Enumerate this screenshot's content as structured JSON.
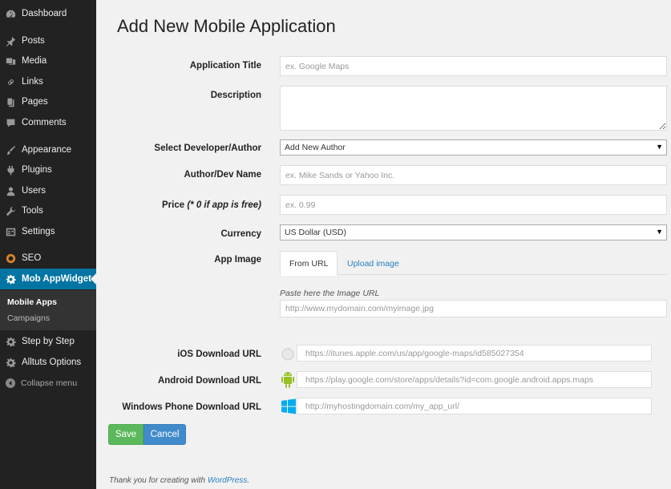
{
  "sidebar": {
    "items": [
      {
        "label": "Dashboard",
        "icon": "dashboard-icon"
      },
      {
        "label": "Posts",
        "icon": "pin-icon"
      },
      {
        "label": "Media",
        "icon": "media-icon"
      },
      {
        "label": "Links",
        "icon": "link-icon"
      },
      {
        "label": "Pages",
        "icon": "pages-icon"
      },
      {
        "label": "Comments",
        "icon": "comment-icon"
      },
      {
        "label": "Appearance",
        "icon": "brush-icon"
      },
      {
        "label": "Plugins",
        "icon": "plugin-icon"
      },
      {
        "label": "Users",
        "icon": "user-icon"
      },
      {
        "label": "Tools",
        "icon": "wrench-icon"
      },
      {
        "label": "Settings",
        "icon": "settings-icon"
      },
      {
        "label": "SEO",
        "icon": "seo-icon"
      },
      {
        "label": "Mob AppWidget",
        "icon": "gear-icon"
      },
      {
        "label": "Step by Step",
        "icon": "gear-icon"
      },
      {
        "label": "Alltuts Options",
        "icon": "gear-icon"
      }
    ],
    "submenu": [
      "Mobile Apps",
      "Campaigns"
    ],
    "collapse_label": "Collapse menu"
  },
  "page": {
    "title": "Add New Mobile Application"
  },
  "form": {
    "app_title_label": "Application Title",
    "app_title_placeholder": "ex. Google Maps",
    "description_label": "Description",
    "developer_label": "Select Developer/Author",
    "developer_value": "Add New Author",
    "author_label": "Author/Dev Name",
    "author_placeholder": "ex. Mike Sands or Yahoo Inc.",
    "price_label": "Price",
    "price_note": "(* 0 if app is free)",
    "price_placeholder": "ex. 0.99",
    "currency_label": "Currency",
    "currency_value": "US Dollar (USD)",
    "image_label": "App Image",
    "tab_from_url": "From URL",
    "tab_upload": "Upload image",
    "image_hint": "Paste here the Image URL",
    "image_placeholder": "http://www.mydomain.com/myimage.jpg",
    "ios_label": "iOS Download URL",
    "ios_placeholder": "https://itunes.apple.com/us/app/google-maps/id585027354",
    "android_label": "Android Download URL",
    "android_placeholder": "https://play.google.com/store/apps/details?id=com.google.android.apps.maps",
    "windows_label": "Windows Phone Download URL",
    "windows_placeholder": "http://myhostingdomain.com/my_app_url/",
    "save_label": "Save",
    "cancel_label": "Cancel"
  },
  "footer": {
    "text": "Thank you for creating with ",
    "link": "WordPress",
    "end": "."
  },
  "colors": {
    "sidebar_bg": "#222222",
    "active_bg": "#0074a2",
    "save": "#5cb85c",
    "cancel": "#428bca",
    "android": "#97c024",
    "windows": "#00adef"
  }
}
